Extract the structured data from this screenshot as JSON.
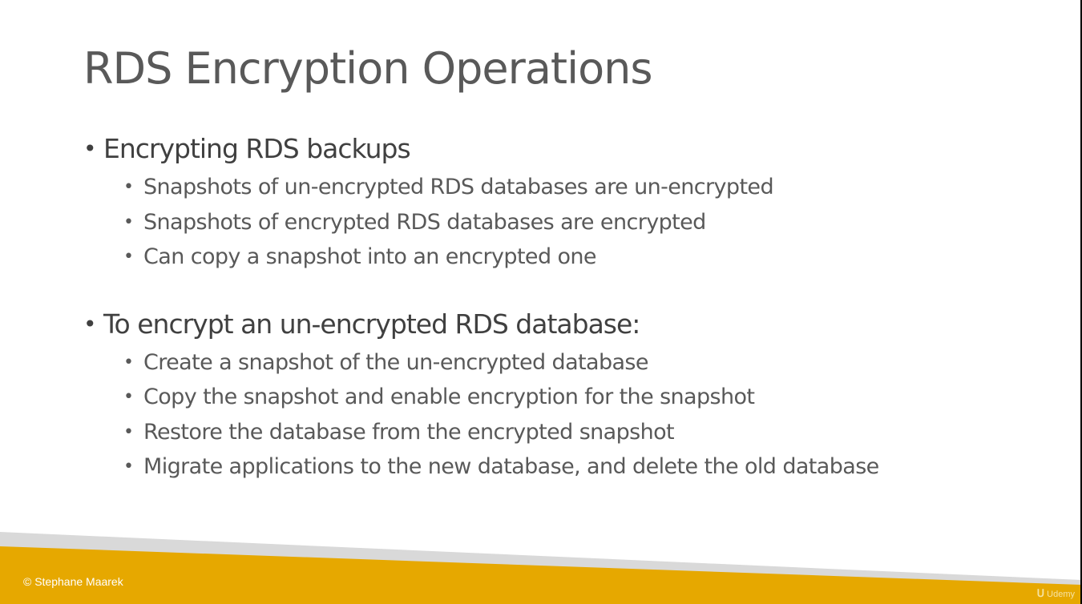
{
  "slide": {
    "title": "RDS Encryption Operations",
    "sections": [
      {
        "heading": "Encrypting RDS backups",
        "items": [
          "Snapshots of un-encrypted RDS databases are un-encrypted",
          "Snapshots of encrypted RDS databases are encrypted",
          "Can copy a snapshot into an encrypted one"
        ]
      },
      {
        "heading": "To encrypt an un-encrypted RDS database:",
        "items": [
          "Create a snapshot of the un-encrypted database",
          "Copy the snapshot and enable encryption for the snapshot",
          "Restore the database from the encrypted snapshot",
          "Migrate applications to the new database, and delete the old database"
        ]
      }
    ],
    "bullet_glyph": "•"
  },
  "footer": {
    "copyright": "© Stephane Maarek",
    "watermark": "Udemy",
    "accent_color": "#E6A800",
    "stripe_color": "#D9D9D9"
  }
}
